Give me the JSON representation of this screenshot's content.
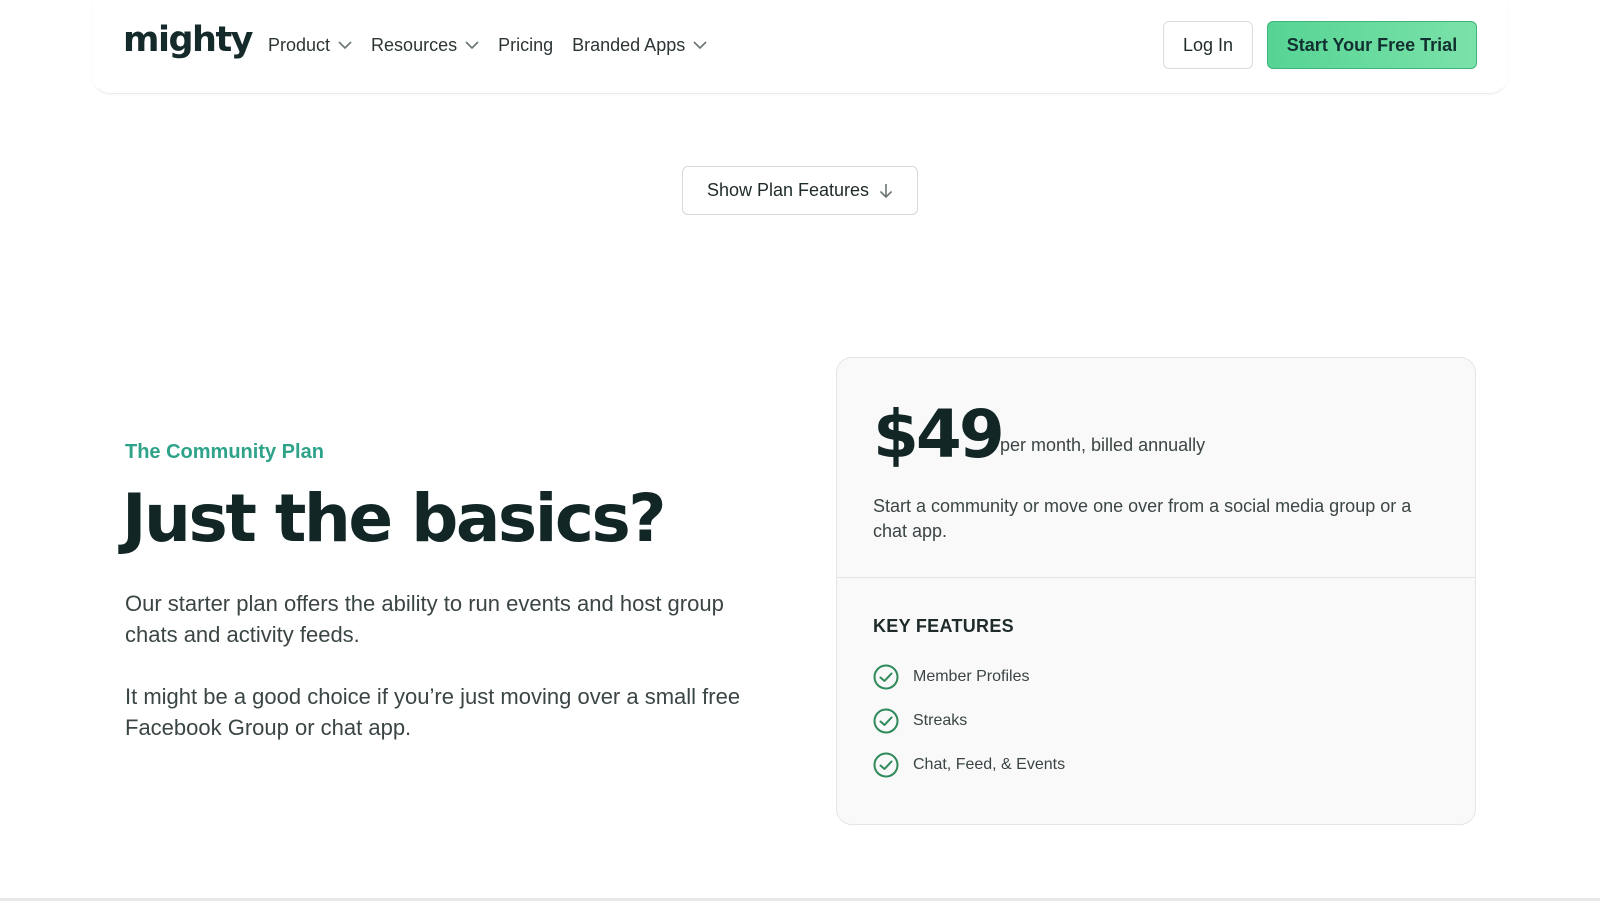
{
  "nav": {
    "logo": "mighty",
    "items": [
      {
        "label": "Product",
        "has_dropdown": true
      },
      {
        "label": "Resources",
        "has_dropdown": true
      },
      {
        "label": "Pricing",
        "has_dropdown": false
      },
      {
        "label": "Branded Apps",
        "has_dropdown": true
      }
    ],
    "login_label": "Log In",
    "trial_label": "Start Your Free Trial"
  },
  "show_features": {
    "label": "Show Plan Features",
    "icon": "arrow-down-icon"
  },
  "plan": {
    "eyebrow": "The Community Plan",
    "headline": "Just the basics?",
    "paragraph_1": "Our starter plan offers the ability to run events and host group chats and activity feeds.",
    "paragraph_2": "It might be a good choice if you’re just moving over a small free Facebook Group or chat app."
  },
  "card": {
    "price": "$49",
    "price_note": "per month, billed annually",
    "description": "Start a community or move one over from a social media group or a chat app.",
    "features_heading": "KEY FEATURES",
    "features": [
      "Member Profiles",
      "Streaks",
      "Chat, Feed, & Events"
    ]
  },
  "colors": {
    "accent_green": "#56d494",
    "eyebrow_teal": "#2fa38a",
    "check_green": "#2e8a5a",
    "heading_dark": "#122626"
  }
}
